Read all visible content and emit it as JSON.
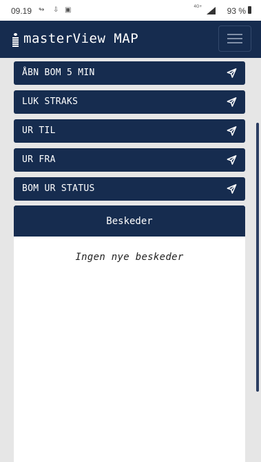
{
  "status_bar": {
    "time": "09.19",
    "network": "4G+",
    "battery": "93 %",
    "icons": [
      "cast-icon",
      "download-icon",
      "image-icon",
      "signal-icon",
      "battery-icon"
    ]
  },
  "app": {
    "title": "masterView MAP",
    "logo_icon": "info-person-icon",
    "menu_icon": "hamburger-icon"
  },
  "commands": [
    {
      "label": "ÅBN BOM 5 MIN",
      "icon": "send-icon"
    },
    {
      "label": "LUK STRAKS",
      "icon": "send-icon"
    },
    {
      "label": "UR TIL",
      "icon": "send-icon"
    },
    {
      "label": "UR FRA",
      "icon": "send-icon"
    },
    {
      "label": "BOM UR STATUS",
      "icon": "send-icon"
    }
  ],
  "messages": {
    "title": "Beskeder",
    "empty_text": "Ingen nye beskeder"
  },
  "colors": {
    "primary": "#162c4f",
    "background": "#e6e6e6",
    "panel": "#ffffff"
  }
}
